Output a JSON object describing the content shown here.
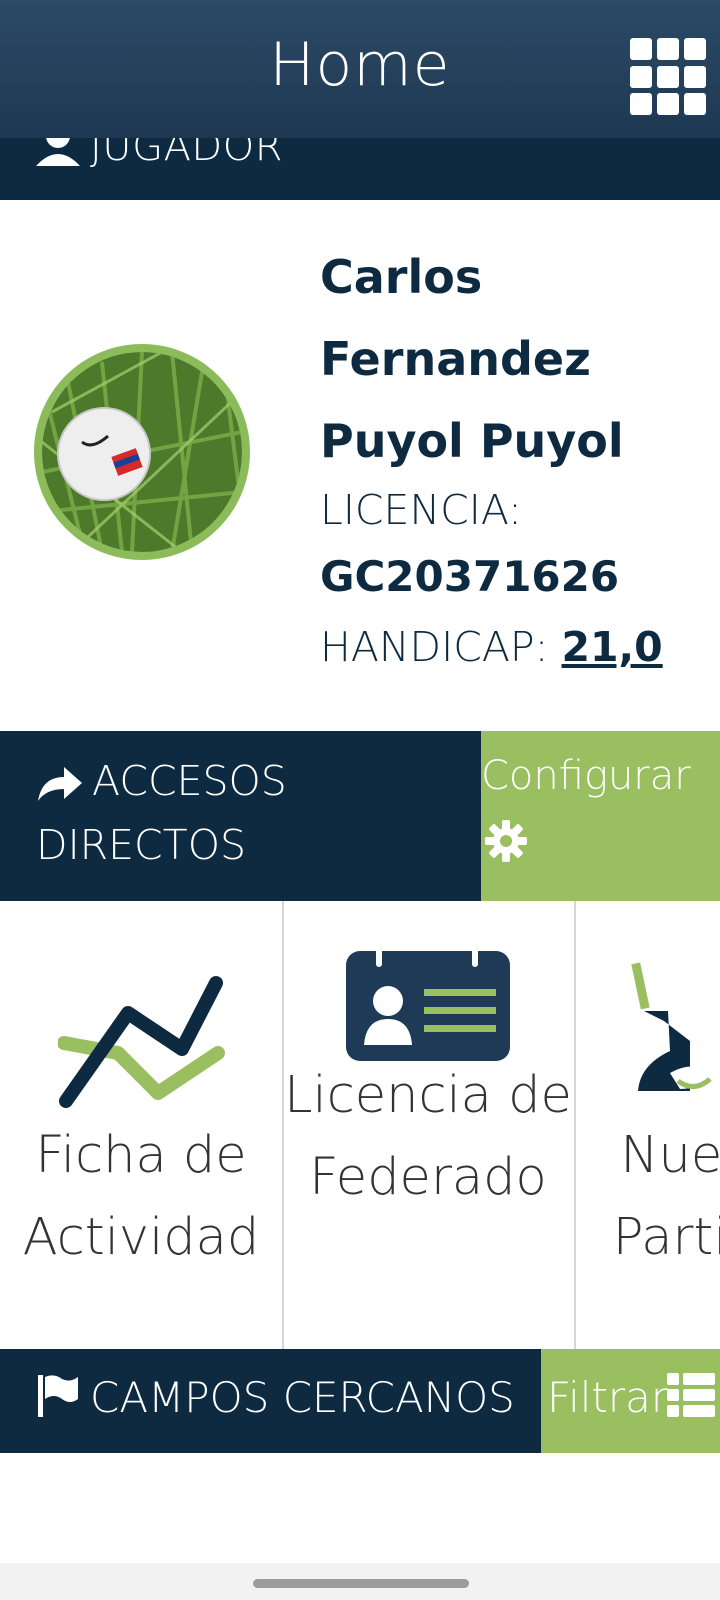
{
  "header": {
    "title": "Home",
    "menu_icon": "grid-menu-icon"
  },
  "jugador": {
    "label": "JUGADOR",
    "icon": "person-icon"
  },
  "player": {
    "name": "Carlos Fernandez Puyol Puyol",
    "licencia_label": "LICENCIA:",
    "licencia_value": "GC20371626",
    "handicap_label": "HANDICAP:",
    "handicap_value": "21,0"
  },
  "accesos": {
    "label": "ACCESOS DIRECTOS",
    "icon": "share-arrow-icon",
    "config_label": "Configurar",
    "config_icon": "gear-icon"
  },
  "tiles": [
    {
      "label": "Ficha de Actividad",
      "icon": "activity-chart-icon"
    },
    {
      "label": "Licencia de Federado",
      "icon": "id-card-icon"
    },
    {
      "label": "Nueva Partida",
      "icon": "golf-club-icon"
    }
  ],
  "campos": {
    "label": "CAMPOS CERCANOS",
    "icon": "flag-icon",
    "filter_label": "Filtrar",
    "filter_icon": "list-icon"
  },
  "colors": {
    "navy": "#0d2a40",
    "header": "#2c4a66",
    "accent_green": "#9abf61",
    "avatar_border": "#8cbb5a"
  }
}
